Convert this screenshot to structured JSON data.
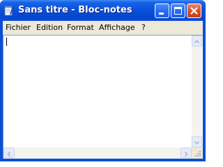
{
  "window": {
    "title": "Sans titre - Bloc-notes",
    "icon": "notepad-icon"
  },
  "titlebar_buttons": {
    "minimize": "minimize-icon",
    "maximize": "maximize-icon",
    "close": "close-icon"
  },
  "menu": {
    "items": [
      {
        "label": "Fichier"
      },
      {
        "label": "Edition"
      },
      {
        "label": "Format"
      },
      {
        "label": "Affichage"
      },
      {
        "label": "?"
      }
    ]
  },
  "editor": {
    "content": ""
  },
  "colors": {
    "titlebar": "#0a52dc",
    "menubar": "#ece9d8",
    "close_button": "#d5542e"
  }
}
